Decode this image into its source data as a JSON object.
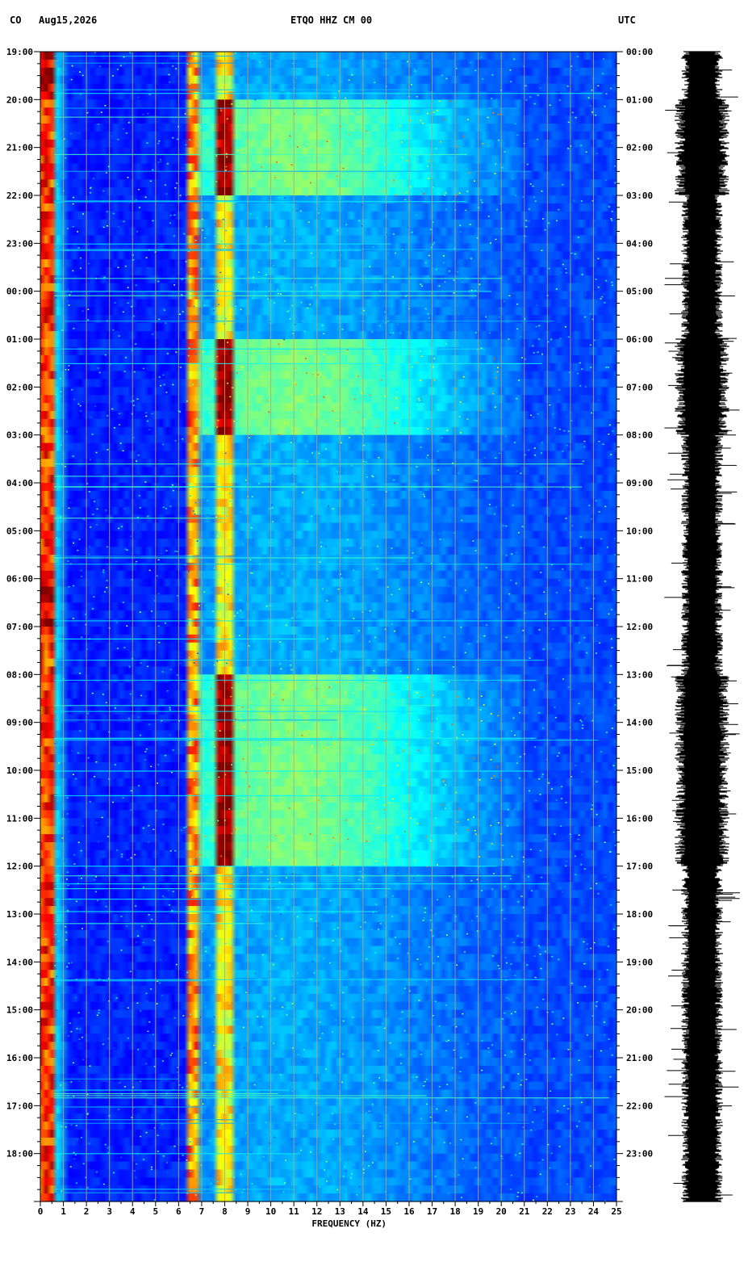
{
  "header": {
    "network": "CO",
    "date": "Aug15,2026",
    "station": "ETQO HHZ CM 00",
    "timezone_label": "UTC"
  },
  "chart_data": {
    "type": "heatmap",
    "title": "ETQO HHZ CM 00",
    "xlabel": "FREQUENCY (HZ)",
    "xlim": [
      0,
      25
    ],
    "x_ticks": [
      "0",
      "1",
      "2",
      "3",
      "4",
      "5",
      "6",
      "7",
      "8",
      "9",
      "10",
      "11",
      "12",
      "13",
      "14",
      "15",
      "16",
      "17",
      "18",
      "19",
      "20",
      "21",
      "22",
      "23",
      "24",
      "25"
    ],
    "left_time_labels": [
      "19:00",
      "20:00",
      "21:00",
      "22:00",
      "23:00",
      "00:00",
      "01:00",
      "02:00",
      "03:00",
      "04:00",
      "05:00",
      "06:00",
      "07:00",
      "08:00",
      "09:00",
      "10:00",
      "11:00",
      "12:00",
      "13:00",
      "14:00",
      "15:00",
      "16:00",
      "17:00",
      "18:00"
    ],
    "right_time_labels": [
      "00:00",
      "01:00",
      "02:00",
      "03:00",
      "04:00",
      "05:00",
      "06:00",
      "07:00",
      "08:00",
      "09:00",
      "10:00",
      "11:00",
      "12:00",
      "13:00",
      "14:00",
      "15:00",
      "16:00",
      "17:00",
      "18:00",
      "19:00",
      "20:00",
      "21:00",
      "22:00",
      "23:00"
    ],
    "hours": 24,
    "colormap": [
      "#00008f",
      "#0000ff",
      "#0080ff",
      "#00ffff",
      "#80ff80",
      "#ffff00",
      "#ff8000",
      "#ff0000",
      "#800000"
    ],
    "persistent_energy_bands_hz": [
      0.3,
      6.7,
      8.0
    ],
    "high_energy_hour_rows": [
      1,
      2,
      6,
      7,
      13,
      14,
      15,
      16
    ],
    "event_hour_rows": [
      0,
      11
    ],
    "colors": {
      "grid": "#c8a060",
      "background": "#ffffff",
      "text": "#000000",
      "trace": "#000000"
    }
  }
}
